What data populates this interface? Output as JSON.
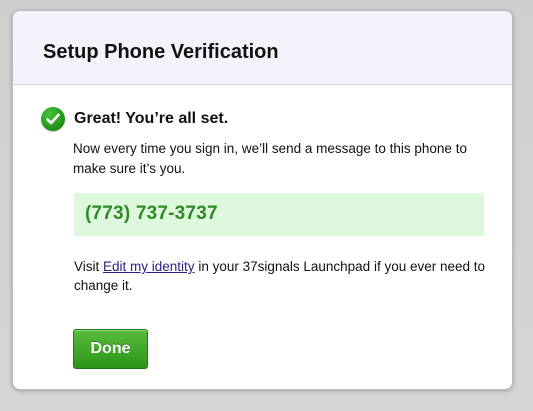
{
  "dialog": {
    "title": "Setup Phone Verification"
  },
  "success": {
    "icon": "check-circle-icon",
    "heading": "Great! You’re all set.",
    "message": "Now every time you sign in, we’ll send a message to this phone to make sure it’s you."
  },
  "phone": {
    "number": "(773) 737-3737"
  },
  "visit": {
    "before": "Visit ",
    "link_text": "Edit my identity",
    "after": " in your 37signals Launchpad if you ever need to change it."
  },
  "actions": {
    "done_label": "Done"
  },
  "colors": {
    "accent_green": "#2d9418",
    "phone_text": "#2f8a28",
    "phone_bg": "#ddf8dd",
    "link": "#2a1e86",
    "header_bg": "#f3f4fb"
  }
}
